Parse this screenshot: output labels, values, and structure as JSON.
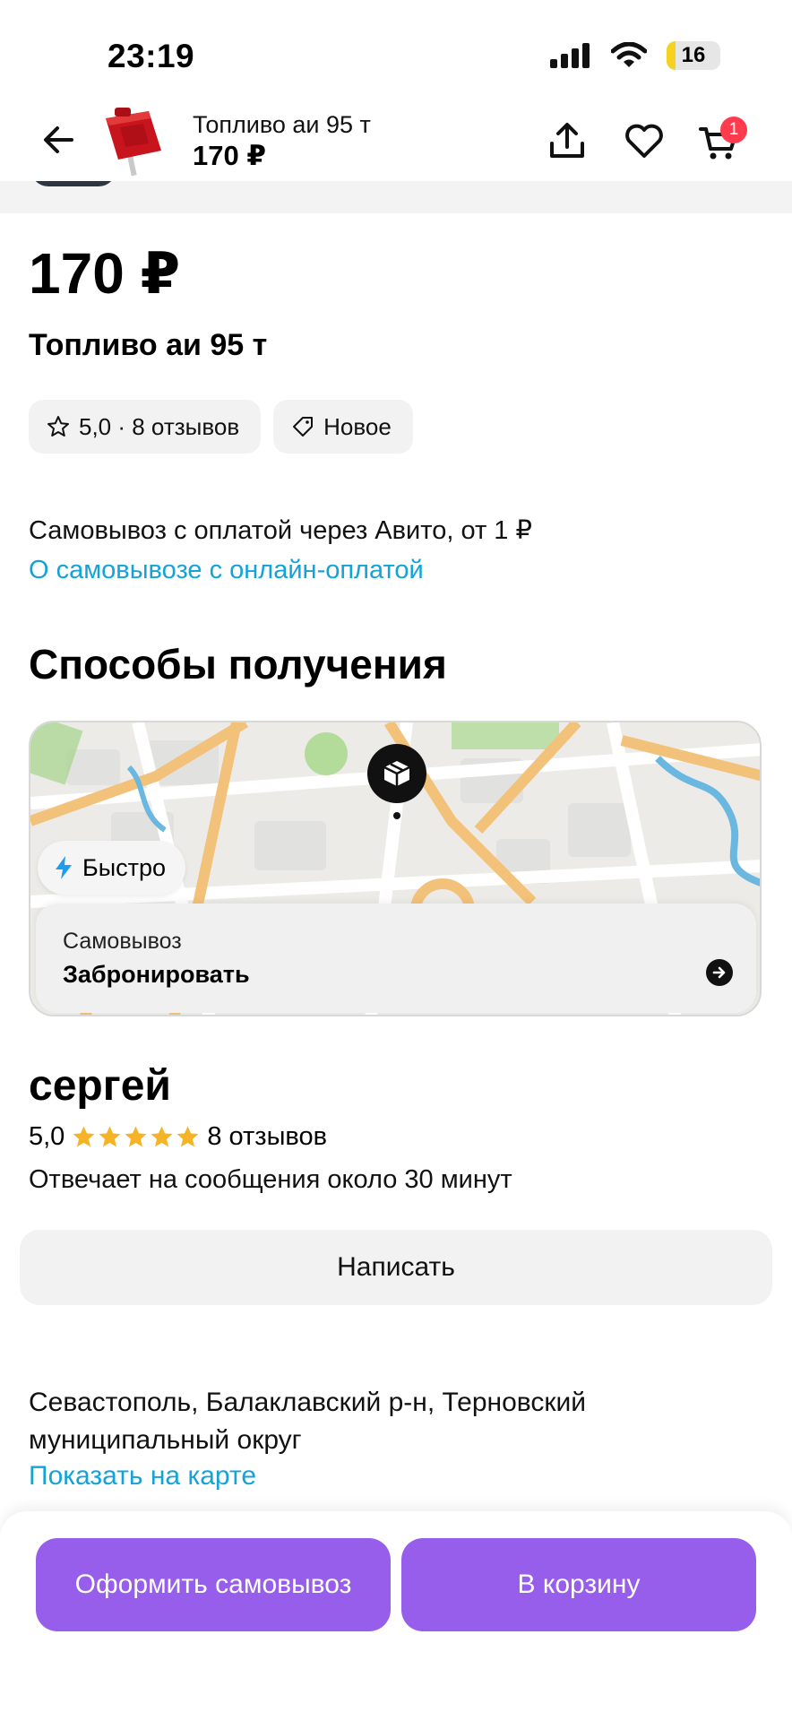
{
  "status_bar": {
    "time": "23:19",
    "battery": "16",
    "battery_level": 0.16
  },
  "header": {
    "title": "Топливо аи 95 т",
    "price": "170 ₽",
    "cart_badge": "1",
    "icons": [
      "back-arrow-icon",
      "share-icon",
      "heart-icon",
      "cart-icon"
    ]
  },
  "product": {
    "price": "170 ₽",
    "title": "Топливо аи 95 т",
    "chips": {
      "rating": "5,0 · 8 отзывов",
      "condition": "Новое"
    }
  },
  "pickup_info": {
    "text": "Самовывоз с оплатой через Авито, от 1 ₽",
    "link": "О самовывозе с онлайн-оплатой"
  },
  "delivery": {
    "section_title": "Способы получения",
    "fast_label": "Быстро",
    "option_label": "Самовывоз",
    "option_action": "Забронировать"
  },
  "seller": {
    "name": "сергей",
    "rating": "5,0",
    "stars": 5,
    "reviews": "8 отзывов",
    "response": "Отвечает на сообщения около 30 минут",
    "write_button": "Написать"
  },
  "location": {
    "address": "Севастополь, Балаклавский р-н, Терновский муниципальный округ",
    "map_link": "Показать на карте"
  },
  "bottom_bar": {
    "pickup_button": "Оформить самовывоз",
    "cart_button": "В корзину"
  },
  "colors": {
    "accent": "#965eeb",
    "link": "#14a3d9",
    "badge": "#ff3b4e",
    "star": "#f5b425"
  }
}
